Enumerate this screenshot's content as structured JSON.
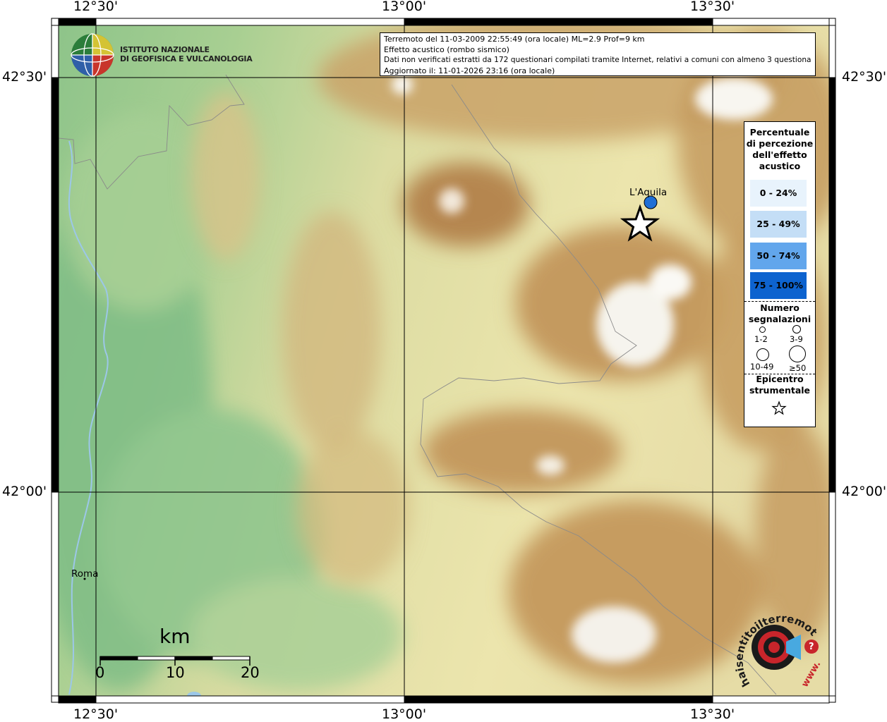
{
  "map": {
    "lat_ticks": [
      "42°30'",
      "42°00'"
    ],
    "lon_ticks": [
      "12°30'",
      "13°00'",
      "13°30'"
    ],
    "places": {
      "laquila": "L'Aquila",
      "roma": "Roma"
    },
    "scale": {
      "title": "km",
      "labels": [
        "0",
        "10",
        "20"
      ]
    },
    "colors": {
      "water": "#9cc7e8",
      "point": "#1f6fd6"
    }
  },
  "info": {
    "line1": "Terremoto del 11-03-2009 22:55:49 (ora locale) ML=2.9 Prof=9 km",
    "line2": "Effetto acustico (rombo sismico)",
    "line3": "Dati non verificati estratti da 172 questionari compilati tramite Internet, relativi a comuni con almeno 3 questionari.",
    "line4": "Aggiornato il: 11-01-2026 23:16 (ora locale)"
  },
  "ingv": {
    "line1": "ISTITUTO NAZIONALE",
    "line2": "DI GEOFISICA E VULCANOLOGIA"
  },
  "legend": {
    "title": [
      "Percentuale",
      "di percezione",
      "dell'effetto",
      "acustico"
    ],
    "classes": [
      {
        "label": "0 - 24%",
        "color": "#e8f3fc"
      },
      {
        "label": "25 - 49%",
        "color": "#c4def6"
      },
      {
        "label": "50 - 74%",
        "color": "#62a6ec"
      },
      {
        "label": "75 - 100%",
        "color": "#0d63cf"
      }
    ],
    "count_title": [
      "Numero",
      "segnalazioni"
    ],
    "counts": [
      "1-2",
      "3-9",
      "10-49",
      "≥50"
    ],
    "epicenter_title": [
      "Epicentro",
      "strumentale"
    ]
  },
  "hsit": {
    "text": "haisentitoilterremoto.it",
    "url_text": "www.",
    "q": "?"
  }
}
